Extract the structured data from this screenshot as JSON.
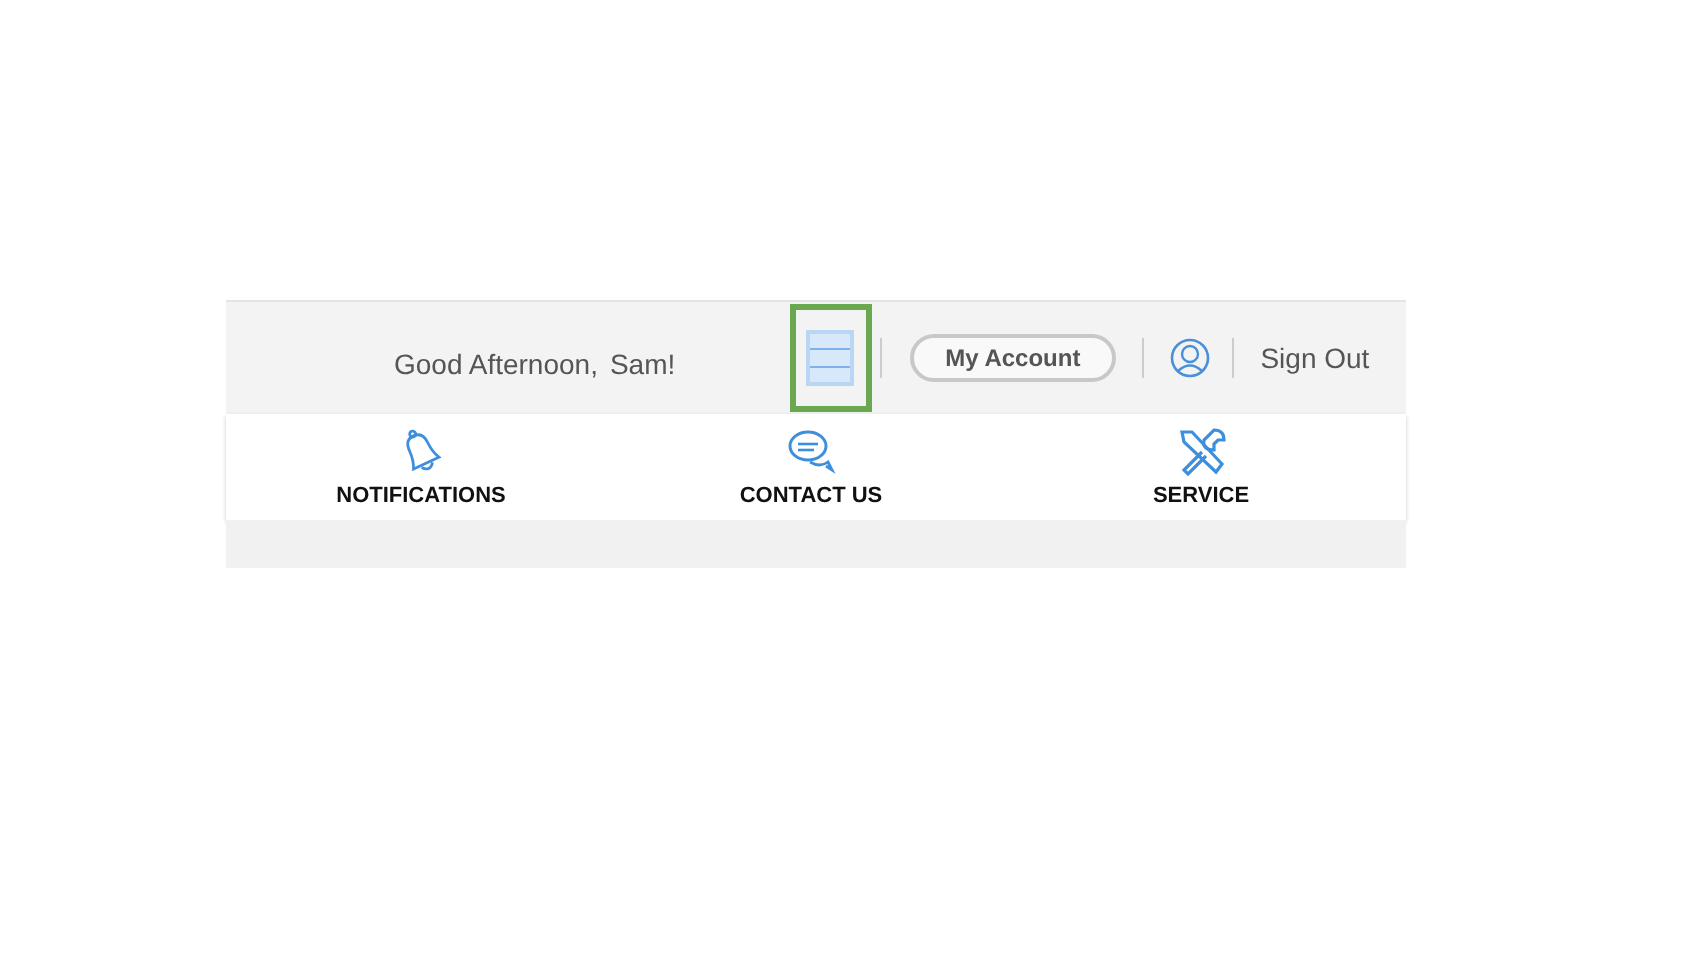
{
  "header": {
    "greeting": "Good Afternoon,",
    "user_name": "Sam!",
    "menu_button": {
      "highlighted": true
    },
    "account_button": "My Account",
    "sign_out": "Sign Out"
  },
  "nav_items": [
    {
      "kind": "bell",
      "label": "NOTIFICATIONS"
    },
    {
      "kind": "chat",
      "label": "CONTACT US"
    },
    {
      "kind": "tools",
      "label": "SERVICE"
    }
  ]
}
